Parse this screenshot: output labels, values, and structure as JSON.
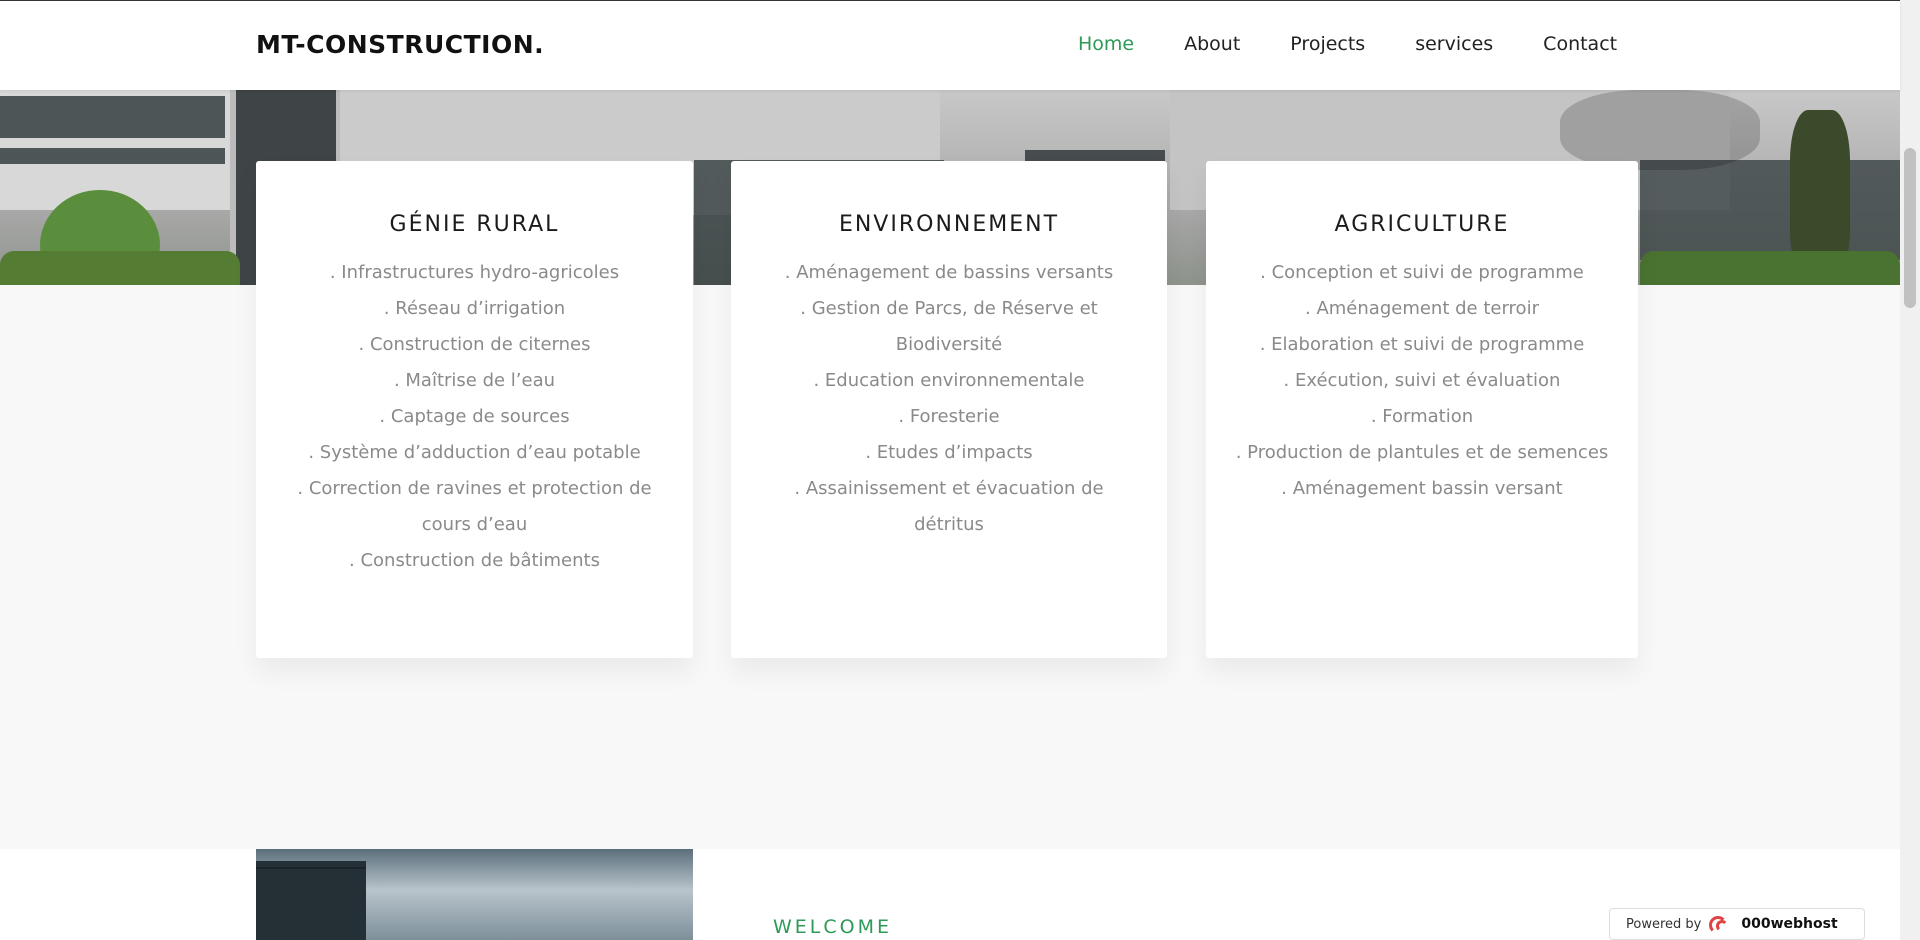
{
  "header": {
    "brand": "MT-CONSTRUCTION.",
    "nav": [
      "Home",
      "About",
      "Projects",
      "services",
      "Contact"
    ],
    "active_nav": "Home"
  },
  "colors": {
    "accent": "#2e9a57"
  },
  "cards": [
    {
      "title": "GÉNIE RURAL",
      "items": [
        ". Infrastructures hydro-agricoles",
        ". Réseau d’irrigation",
        ". Construction de citernes",
        ". Maîtrise de l’eau",
        ". Captage de sources",
        ". Système d’adduction d’eau potable",
        ". Correction de ravines et protection de cours d’eau",
        ". Construction de bâtiments"
      ]
    },
    {
      "title": "ENVIRONNEMENT",
      "items": [
        ". Aménagement de bassins versants",
        ". Gestion de Parcs, de Réserve et Biodiversité",
        ". Education environnementale",
        ". Foresterie",
        ". Etudes d’impacts",
        ". Assainissement et évacuation de détritus"
      ]
    },
    {
      "title": "AGRICULTURE",
      "items": [
        ". Conception et suivi de programme",
        ". Aménagement de terroir",
        ". Elaboration et suivi de programme",
        ". Exécution, suivi et évaluation",
        ". Formation",
        ". Production de plantules et de semences",
        ". Aménagement bassin versant"
      ]
    }
  ],
  "welcome": {
    "label": "WELCOME"
  },
  "powered": {
    "prefix": "Powered by",
    "host": "000webhost"
  }
}
